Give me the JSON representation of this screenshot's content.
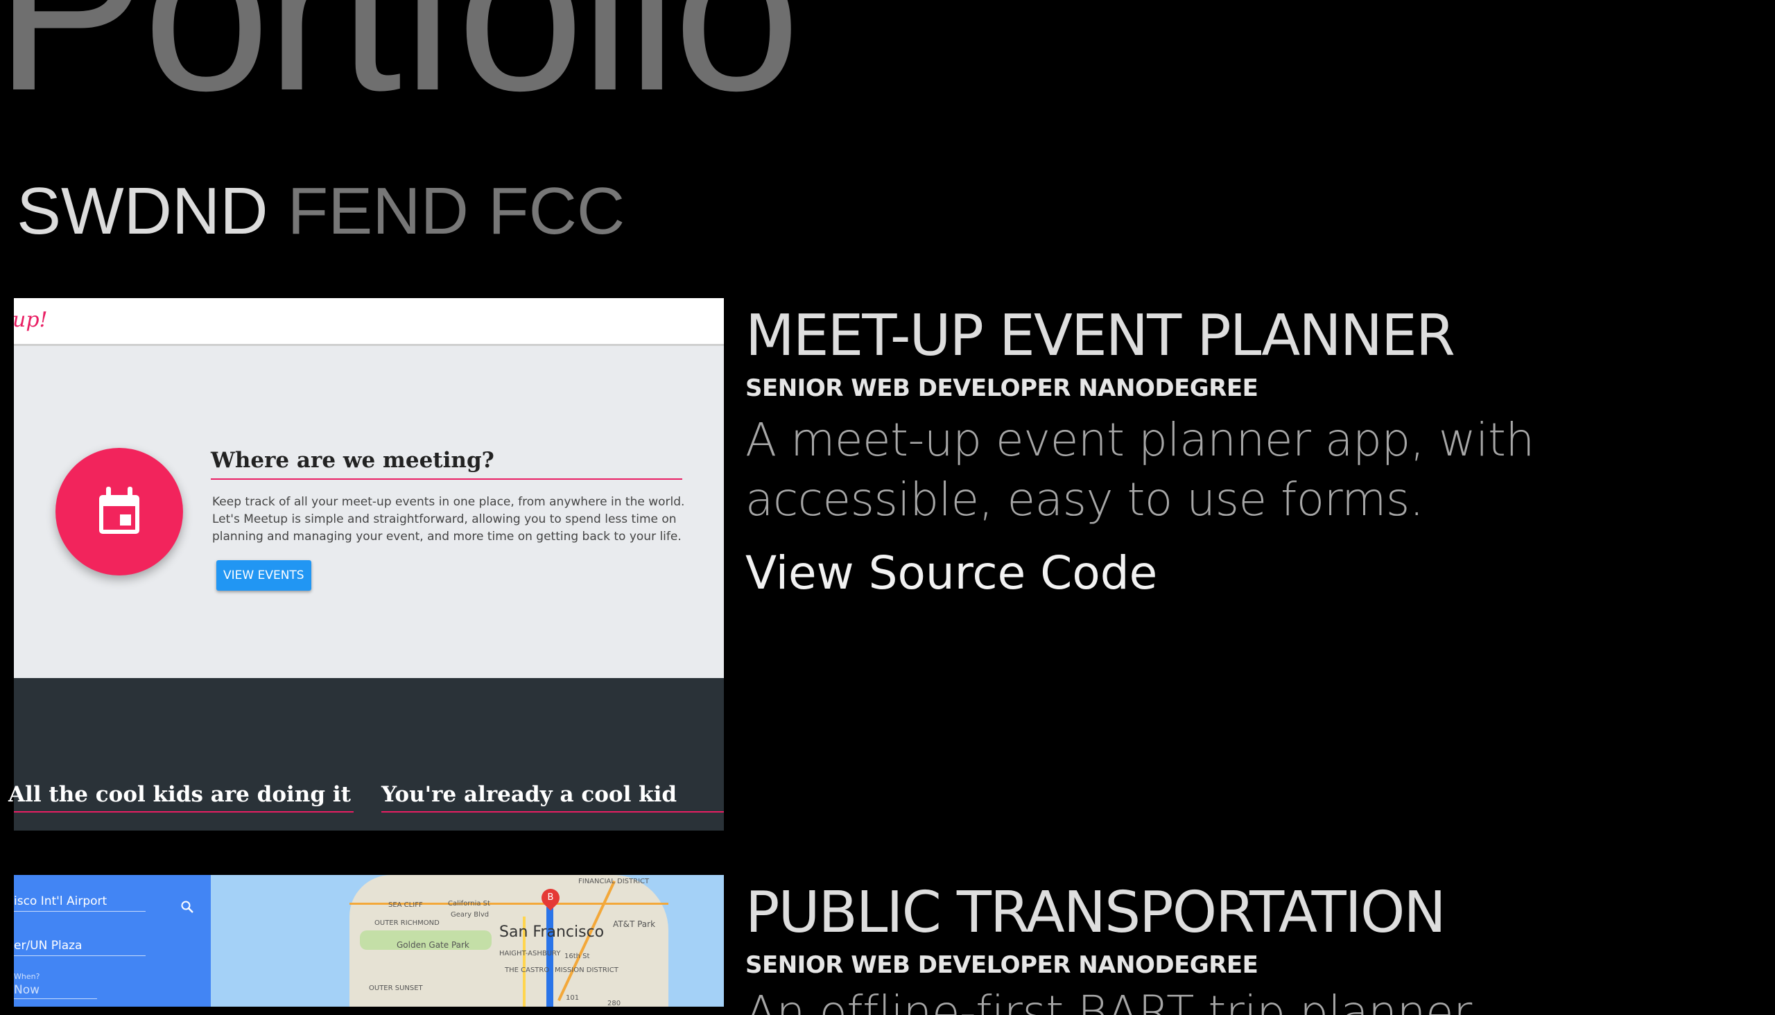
{
  "hero": {
    "title": "Portfolio"
  },
  "tabs": [
    {
      "label": "SWDND",
      "active": true
    },
    {
      "label": "FEND",
      "active": false
    },
    {
      "label": "FCC",
      "active": false
    }
  ],
  "projects": [
    {
      "title": "MEET-UP EVENT PLANNER",
      "subtitle": "SENIOR WEB DEVELOPER NANODEGREE",
      "description": "A meet-up event planner app, with accessible, easy to use forms.",
      "link": "View Source Code",
      "thumbnail": {
        "logo": "up!",
        "heading": "Where are we meeting?",
        "paragraph": "Keep track of all your meet-up events in one place, from anywhere in the world. Let's Meetup is simple and straightforward, allowing you to spend less time on planning and managing your event, and more time on getting back to your life.",
        "button": "VIEW EVENTS",
        "bottom_left": "All the cool kids are doing it",
        "bottom_right": "You're already a cool kid",
        "icon": "calendar-icon",
        "accent": "#f2245c"
      }
    },
    {
      "title": "PUBLIC TRANSPORTATION",
      "subtitle": "SENIOR WEB DEVELOPER NANODEGREE",
      "description": "An offline-first BART trip planner",
      "thumbnail": {
        "from": "isco Int'l Airport",
        "to": "er/UN Plaza",
        "when_label": "When?",
        "when_value": "Now",
        "city": "San Francisco",
        "pin": "B",
        "icon": "search-icon",
        "map_labels": {
          "sea_cliff": "SEA CLIFF",
          "california_st": "California St",
          "geary_blvd": "Geary Blvd",
          "outer_richmond": "OUTER RICHMOND",
          "golden_gate_park": "Golden Gate Park",
          "haight_ashbury": "HAIGHT-ASHBURY",
          "the_castro": "THE CASTRO",
          "mission_district": "MISSION DISTRICT",
          "outer_sunset": "OUTER SUNSET",
          "financial_district": "FINANCIAL DISTRICT",
          "att_park": "AT&T Park",
          "route_101": "101",
          "route_280": "280",
          "sixteenth_st": "16th St"
        }
      }
    }
  ]
}
